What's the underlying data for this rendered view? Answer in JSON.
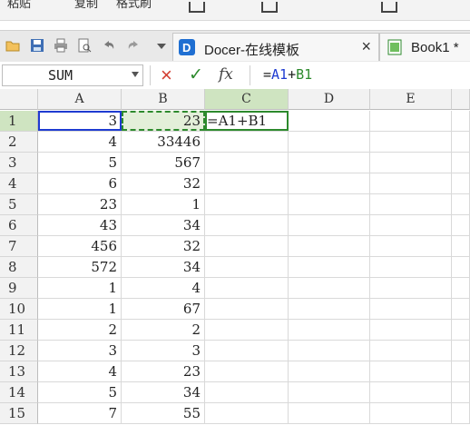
{
  "top_strip": {
    "items": [
      "粘贴",
      "复制",
      "格式刷"
    ]
  },
  "tab_bar": {
    "tabs": [
      {
        "label": "Docer-在线模板",
        "close": "×"
      },
      {
        "label": "Book1 *"
      }
    ]
  },
  "formula_bar": {
    "name_box": "SUM",
    "cancel_symbol": "×",
    "confirm_symbol": "✓",
    "fx_label": "fx",
    "formula_prefix": "=",
    "formula_ref1": "A1",
    "formula_op": "+",
    "formula_ref2": "B1"
  },
  "sheet": {
    "columns": [
      "A",
      "B",
      "C",
      "D",
      "E"
    ],
    "rows": [
      {
        "num": "1",
        "A": "3",
        "B": "23",
        "C": "=A1+B1"
      },
      {
        "num": "2",
        "A": "4",
        "B": "33446",
        "C": ""
      },
      {
        "num": "3",
        "A": "5",
        "B": "567",
        "C": ""
      },
      {
        "num": "4",
        "A": "6",
        "B": "32",
        "C": ""
      },
      {
        "num": "5",
        "A": "23",
        "B": "1",
        "C": ""
      },
      {
        "num": "6",
        "A": "43",
        "B": "34",
        "C": ""
      },
      {
        "num": "7",
        "A": "456",
        "B": "32",
        "C": ""
      },
      {
        "num": "8",
        "A": "572",
        "B": "34",
        "C": ""
      },
      {
        "num": "9",
        "A": "1",
        "B": "4",
        "C": ""
      },
      {
        "num": "10",
        "A": "1",
        "B": "67",
        "C": ""
      },
      {
        "num": "11",
        "A": "2",
        "B": "2",
        "C": ""
      },
      {
        "num": "12",
        "A": "3",
        "B": "3",
        "C": ""
      },
      {
        "num": "13",
        "A": "4",
        "B": "23",
        "C": ""
      },
      {
        "num": "14",
        "A": "5",
        "B": "34",
        "C": ""
      },
      {
        "num": "15",
        "A": "7",
        "B": "55",
        "C": ""
      }
    ]
  },
  "colors": {
    "ref1": "#1f3bd1",
    "ref2": "#2d8a2d",
    "accent_green": "#2d8a2d",
    "blue_logo": "#1f6fd2"
  }
}
